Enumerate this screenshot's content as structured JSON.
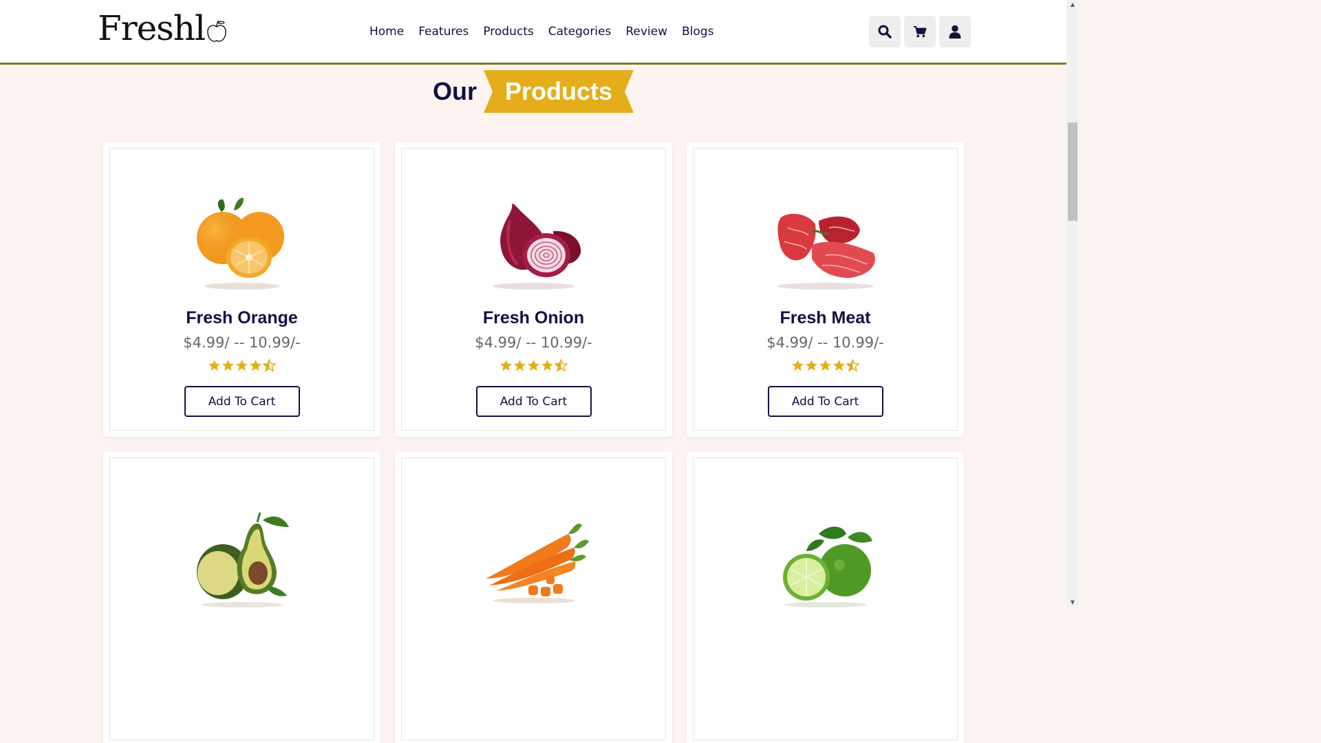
{
  "header": {
    "logo_text": "Freshl",
    "nav": [
      "Home",
      "Features",
      "Products",
      "Categories",
      "Review",
      "Blogs"
    ],
    "icons": [
      "search-icon",
      "cart-icon",
      "user-icon"
    ]
  },
  "section": {
    "title_plain": "Our",
    "title_highlight": "Products"
  },
  "products": [
    {
      "name": "Fresh Orange",
      "price": "$4.99/ -- 10.99/-",
      "rating": 4.5,
      "button": "Add To Cart"
    },
    {
      "name": "Fresh Onion",
      "price": "$4.99/ -- 10.99/-",
      "rating": 4.5,
      "button": "Add To Cart"
    },
    {
      "name": "Fresh Meat",
      "price": "$4.99/ -- 10.99/-",
      "rating": 4.5,
      "button": "Add To Cart"
    },
    {
      "name": "",
      "price": "",
      "button": ""
    },
    {
      "name": "",
      "price": "",
      "button": ""
    },
    {
      "name": "",
      "price": "",
      "button": ""
    }
  ],
  "colors": {
    "accent": "#e3ae19",
    "text_dark": "#130f40",
    "background": "#fdf3f1",
    "header_border": "#7f7a1c"
  }
}
